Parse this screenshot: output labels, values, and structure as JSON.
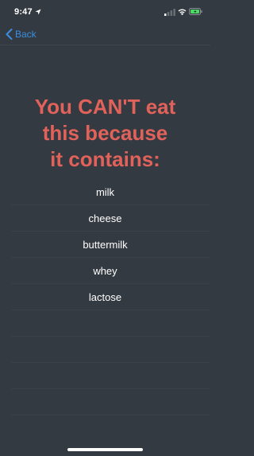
{
  "status_bar": {
    "time": "9:47"
  },
  "nav": {
    "back_label": "Back"
  },
  "headline": {
    "line1": "You CAN'T eat",
    "line2": "this because",
    "line3": "it contains:"
  },
  "ingredients": [
    {
      "label": "milk"
    },
    {
      "label": "cheese"
    },
    {
      "label": "buttermilk"
    },
    {
      "label": "whey"
    },
    {
      "label": "lactose"
    }
  ],
  "colors": {
    "background": "#343a41",
    "headline": "#e0625a",
    "accent": "#3b8de0",
    "battery": "#4cd964"
  },
  "icons": [
    "location-arrow-icon",
    "cellular-signal-icon",
    "wifi-icon",
    "battery-icon",
    "chevron-left-icon"
  ]
}
